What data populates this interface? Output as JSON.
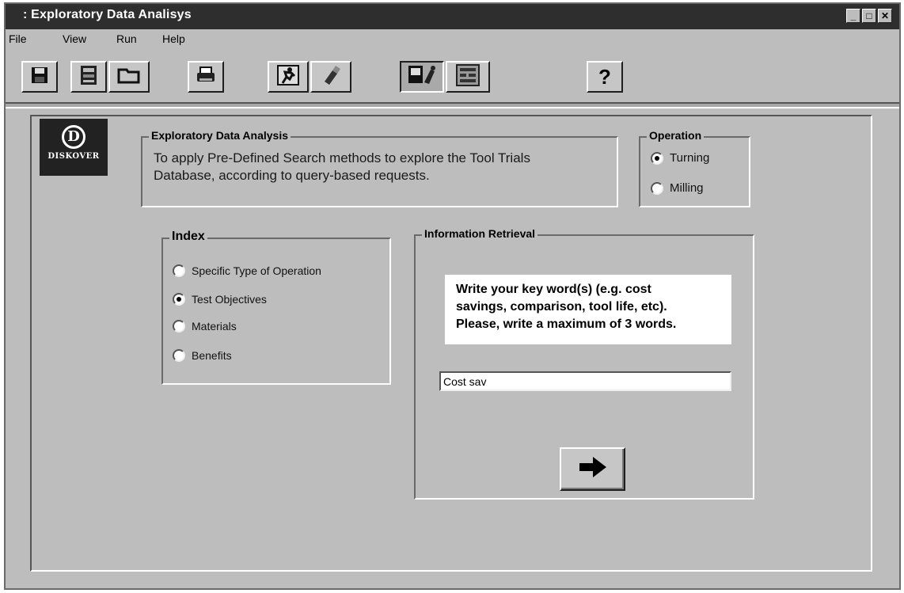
{
  "window": {
    "title": ": Exploratory Data Analisys",
    "controls": {
      "minimize": "_",
      "maximize": "□",
      "close": "✕"
    }
  },
  "menubar": {
    "items": [
      "File",
      "View",
      "Run",
      "Help"
    ]
  },
  "toolbar": {
    "buttons": [
      {
        "icon": "save-icon"
      },
      {
        "icon": "database-icon"
      },
      {
        "icon": "folder-icon"
      },
      {
        "icon": "print-icon"
      },
      {
        "icon": "run-icon"
      },
      {
        "icon": "clear-icon"
      },
      {
        "icon": "explore-icon"
      },
      {
        "icon": "report-icon"
      },
      {
        "icon": "help-icon",
        "glyph": "?"
      }
    ]
  },
  "logo": {
    "text": "DISKOVER",
    "mark": "D"
  },
  "eda": {
    "legend": "Exploratory Data Analysis",
    "description_line1": "To apply Pre-Defined Search methods to explore the Tool Trials",
    "description_line2": "Database, according to query-based requests."
  },
  "operation": {
    "legend": "Operation",
    "options": [
      {
        "label": "Turning",
        "selected": true
      },
      {
        "label": "Milling",
        "selected": false
      }
    ]
  },
  "index": {
    "legend": "Index",
    "options": [
      {
        "label": "Specific Type of Operation",
        "selected": false
      },
      {
        "label": "Test Objectives",
        "selected": true
      },
      {
        "label": "Materials",
        "selected": false
      },
      {
        "label": "Benefits",
        "selected": false
      }
    ]
  },
  "info": {
    "legend": "Information Retrieval",
    "note_line1": "Write your key word(s) (e.g. cost",
    "note_line2": "savings, comparison, tool life, etc).",
    "note_line3": "Please, write a maximum of 3 words.",
    "keyword_value": "Cost sav",
    "go_icon": "arrow-right-icon"
  },
  "colors": {
    "window_bg": "#bdbdbd",
    "titlebar_bg": "#2e2e2e",
    "note_bg": "#ffffff"
  }
}
